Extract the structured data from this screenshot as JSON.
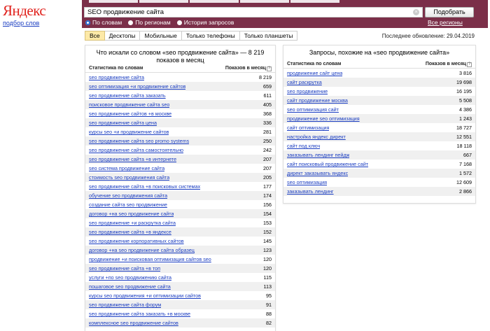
{
  "logo": {
    "brand": "Яндекс",
    "sub": "подбор слов"
  },
  "search": {
    "value": "SEO продвижение сайта",
    "button": "Подобрать"
  },
  "radios": [
    {
      "label": "По словам",
      "selected": true
    },
    {
      "label": "По регионам",
      "selected": false
    },
    {
      "label": "История запросов",
      "selected": false
    }
  ],
  "all_regions": "Все регионы",
  "device_tabs": [
    "Все",
    "Десктопы",
    "Мобильные",
    "Только телефоны",
    "Только планшеты"
  ],
  "updated": "Последнее обновление: 29.04.2019",
  "left": {
    "title": "Что искали со словом «seo продвижение сайта» — 8 219 показов в месяц",
    "col1": "Статистика по словам",
    "col2": "Показов в месяц",
    "rows": [
      [
        "seo продвижение сайта",
        "8 219"
      ],
      [
        "seo оптимизация +и продвижение сайтов",
        "659"
      ],
      [
        "seo продвижение сайта заказать",
        "611"
      ],
      [
        "поисковое продвижение сайта seo",
        "405"
      ],
      [
        "seo продвижение сайтов +в москве",
        "368"
      ],
      [
        "seo продвижение сайта цена",
        "336"
      ],
      [
        "курсы seo +и продвижение сайтов",
        "281"
      ],
      [
        "seo продвижение сайта seo promo systems",
        "250"
      ],
      [
        "seo продвижение сайта самостоятельно",
        "242"
      ],
      [
        "seo продвижение сайта +в интернете",
        "207"
      ],
      [
        "seo система продвижение сайта",
        "207"
      ],
      [
        "стоимость seo продвижения сайта",
        "205"
      ],
      [
        "seo продвижение сайта +в поисковых системах",
        "177"
      ],
      [
        "обучение seo продвижения сайта",
        "174"
      ],
      [
        "создание сайта seo продвижение",
        "156"
      ],
      [
        "договор +на seo продвижение сайта",
        "154"
      ],
      [
        "seo продвижение +и раскрутка сайта",
        "153"
      ],
      [
        "seo продвижение сайта +в яндексе",
        "152"
      ],
      [
        "seo продвижение корпоративных сайтов",
        "145"
      ],
      [
        "договор +на seo продвижение сайта образец",
        "123"
      ],
      [
        "продвижение +и поисковая оптимизация сайтов seo",
        "120"
      ],
      [
        "seo продвижение сайта +в топ",
        "120"
      ],
      [
        "услуги +по seo продвижению сайта",
        "115"
      ],
      [
        "пошаговое seo продвижение сайта",
        "113"
      ],
      [
        "курсы seo продвижения +и оптимизации сайтов",
        "95"
      ],
      [
        "seo продвижение сайта форум",
        "91"
      ],
      [
        "seo продвижение сайта заказать +в москве",
        "88"
      ],
      [
        "комплексное seo продвижение сайтов",
        "82"
      ]
    ]
  },
  "right": {
    "title": "Запросы, похожие на «seo продвижение сайта»",
    "col1": "Статистика по словам",
    "col2": "Показов в месяц",
    "rows": [
      [
        "продвижение сайт цена",
        "3 816"
      ],
      [
        "сайт раскрутка",
        "19 698"
      ],
      [
        "seo продвижение",
        "16 195"
      ],
      [
        "сайт продвижение москва",
        "5 508"
      ],
      [
        "seo оптимизация сайт",
        "4 386"
      ],
      [
        "продвижение seo оптимизация",
        "1 243"
      ],
      [
        "сайт оптимизация",
        "18 727"
      ],
      [
        "настройка яндекс директ",
        "12 551"
      ],
      [
        "сайт под ключ",
        "18 118"
      ],
      [
        "заказывать лендинг пейдж",
        "667"
      ],
      [
        "сайт поисковый продвижение сайт",
        "7 168"
      ],
      [
        "директ заказывать яндекс",
        "1 572"
      ],
      [
        "seo оптимизация",
        "12 609"
      ],
      [
        "заказывать лендинг",
        "2 866"
      ]
    ]
  }
}
